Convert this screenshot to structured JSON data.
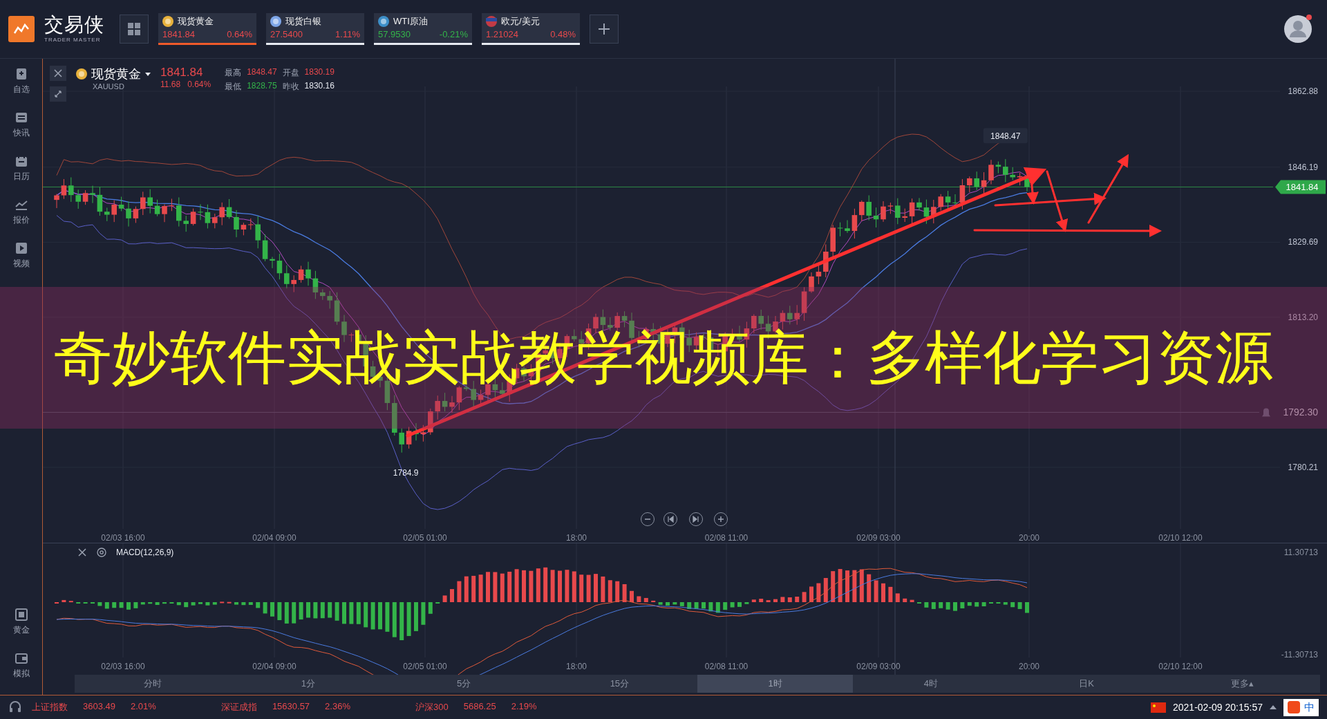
{
  "app": {
    "logo_name": "交易侠",
    "logo_tagline": "TRADER MASTER"
  },
  "tickers": [
    {
      "kind": "gold",
      "name": "现货黄金",
      "price": "1841.84",
      "change": "0.64%",
      "color": "#e8494c",
      "selected": true
    },
    {
      "kind": "silver",
      "name": "现货白银",
      "price": "27.5400",
      "change": "1.11%",
      "color": "#e8494c",
      "selected": false
    },
    {
      "kind": "oil",
      "name": "WTI原油",
      "price": "57.9530",
      "change": "-0.21%",
      "color": "#33b449",
      "selected": false
    },
    {
      "kind": "flag",
      "name": "欧元/美元",
      "price": "1.21024",
      "change": "0.48%",
      "color": "#e8494c",
      "selected": false
    }
  ],
  "sidebar": {
    "top": [
      {
        "kind": "bookmark",
        "label": "自选"
      },
      {
        "kind": "news",
        "label": "快讯"
      },
      {
        "kind": "calendar",
        "label": "日历"
      },
      {
        "kind": "quote",
        "label": "报价"
      },
      {
        "kind": "video",
        "label": "视频"
      }
    ],
    "bottom": [
      {
        "kind": "gold",
        "label": "黄金"
      },
      {
        "kind": "wallet",
        "label": "模拟"
      }
    ]
  },
  "chart_header": {
    "symbol": "现货黄金",
    "code": "XAUUSD",
    "price": "1841.84",
    "change": "11.68",
    "change_pct": "0.64%",
    "stats": [
      {
        "label": "最高",
        "value": "1848.47",
        "color": "#e8494c"
      },
      {
        "label": "开盘",
        "value": "1830.19",
        "color": "#e8494c"
      },
      {
        "label": "最低",
        "value": "1828.75",
        "color": "#33b449"
      },
      {
        "label": "昨收",
        "value": "1830.16",
        "color": "#e4e7ee"
      }
    ]
  },
  "main_chart": {
    "y_labels": [
      "1862.88",
      "1846.19",
      "1829.69",
      "1813.20",
      "1780.21"
    ],
    "x_labels": [
      "02/03 16:00",
      "02/04 09:00",
      "02/05 01:00",
      "18:00",
      "02/08 11:00",
      "02/09 03:00",
      "20:00",
      "02/10 12:00"
    ],
    "high_label": "1848.47",
    "low_label": "1784.9",
    "price_tag": "1841.84",
    "alert_price": "1792.30",
    "nav_buttons": [
      {
        "kind": "minus"
      },
      {
        "kind": "first"
      },
      {
        "kind": "last"
      },
      {
        "kind": "plus"
      }
    ]
  },
  "macd": {
    "title": "MACD(12,26,9)",
    "max_label": "11.30713",
    "min_label": "-11.30713",
    "x_labels": [
      "02/03 16:00",
      "02/04 09:00",
      "02/05 01:00",
      "18:00",
      "02/08 11:00",
      "02/09 03:00",
      "20:00",
      "02/10 12:00"
    ]
  },
  "timeframes": [
    {
      "label": "分时",
      "selected": false
    },
    {
      "label": "1分",
      "selected": false
    },
    {
      "label": "5分",
      "selected": false
    },
    {
      "label": "15分",
      "selected": false
    },
    {
      "label": "1时",
      "selected": true
    },
    {
      "label": "4时",
      "selected": false
    },
    {
      "label": "日K",
      "selected": false
    },
    {
      "label": "更多▴",
      "selected": false
    }
  ],
  "status_bar": {
    "indices": [
      {
        "name": "上证指数",
        "value": "3603.49",
        "change": "2.01%",
        "color": "#e8494c"
      },
      {
        "name": "深证成指",
        "value": "15630.57",
        "change": "2.36%",
        "color": "#e8494c"
      },
      {
        "name": "沪深300",
        "value": "5686.25",
        "change": "2.19%",
        "color": "#e8494c"
      }
    ],
    "datetime": "2021-02-09 20:15:57",
    "ime_label": "中"
  },
  "caption": "奇妙软件实战实战教学视频库：多样化学习资源"
}
